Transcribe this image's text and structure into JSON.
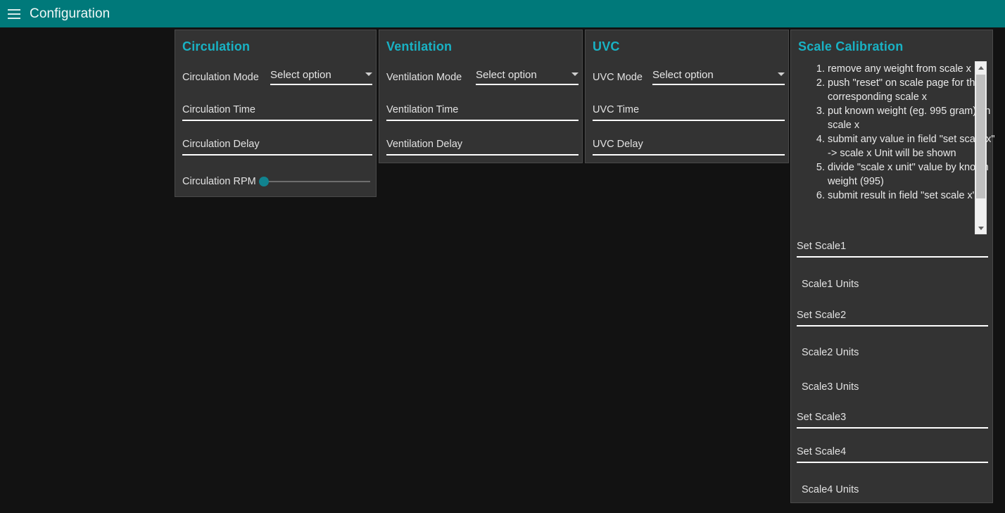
{
  "appbar": {
    "menu_icon": "hamburger-menu-icon",
    "title": "Configuration",
    "color": "#00797a"
  },
  "theme": {
    "background": "#121212",
    "card_background": "#333333",
    "card_border": "#4a4a4a",
    "accent": "#19b2c4",
    "text": "#e2e2e2",
    "slider_thumb": "#11838f"
  },
  "panels": {
    "circulation": {
      "title": "Circulation",
      "mode_label": "Circulation Mode",
      "mode_value": "Select option",
      "time_placeholder": "Circulation Time",
      "delay_placeholder": "Circulation Delay",
      "rpm_label": "Circulation RPM",
      "rpm_value": 0
    },
    "ventilation": {
      "title": "Ventilation",
      "mode_label": "Ventilation Mode",
      "mode_value": "Select option",
      "time_placeholder": "Ventilation Time",
      "delay_placeholder": "Ventilation Delay"
    },
    "uvc": {
      "title": "UVC",
      "mode_label": "UVC Mode",
      "mode_value": "Select option",
      "time_placeholder": "UVC Time",
      "delay_placeholder": "UVC Delay"
    },
    "scale_calibration": {
      "title": "Scale Calibration",
      "instructions": [
        "remove any weight from scale x",
        "push \"reset\" on scale page for the corresponding scale x",
        "put known weight (eg. 995 gram) on scale x",
        "submit any value in field \"set scale x\" -> scale x Unit will be shown",
        "divide \"scale x unit\" value by known weight (995)",
        "submit result in field \"set scale x\""
      ],
      "set_scale1_placeholder": "Set Scale1",
      "scale1_units_label": "Scale1 Units",
      "set_scale2_placeholder": "Set Scale2",
      "scale2_units_label": "Scale2 Units",
      "scale3_units_label": "Scale3 Units",
      "set_scale3_placeholder": "Set Scale3",
      "set_scale4_placeholder": "Set Scale4",
      "scale4_units_label": "Scale4 Units"
    }
  }
}
